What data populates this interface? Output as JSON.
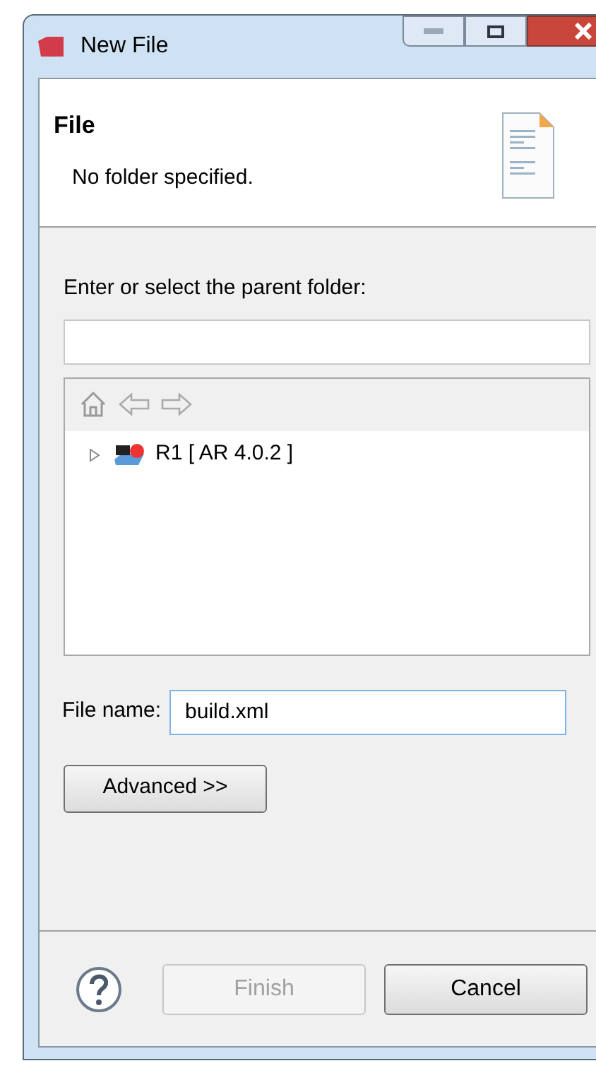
{
  "window": {
    "title": "New File"
  },
  "header": {
    "title": "File",
    "message": "No folder specified."
  },
  "parent_folder": {
    "label": "Enter or select the parent folder:"
  },
  "tree": {
    "items": [
      {
        "label": "R1 [ AR 4.0.2 ]",
        "expanded": false
      }
    ]
  },
  "file_name": {
    "label": "File name:",
    "value": "build.xml"
  },
  "advanced_button": "Advanced >>",
  "buttons": [
    {
      "label": "Finish",
      "disabled": true
    },
    {
      "label": "Cancel",
      "disabled": false
    }
  ]
}
